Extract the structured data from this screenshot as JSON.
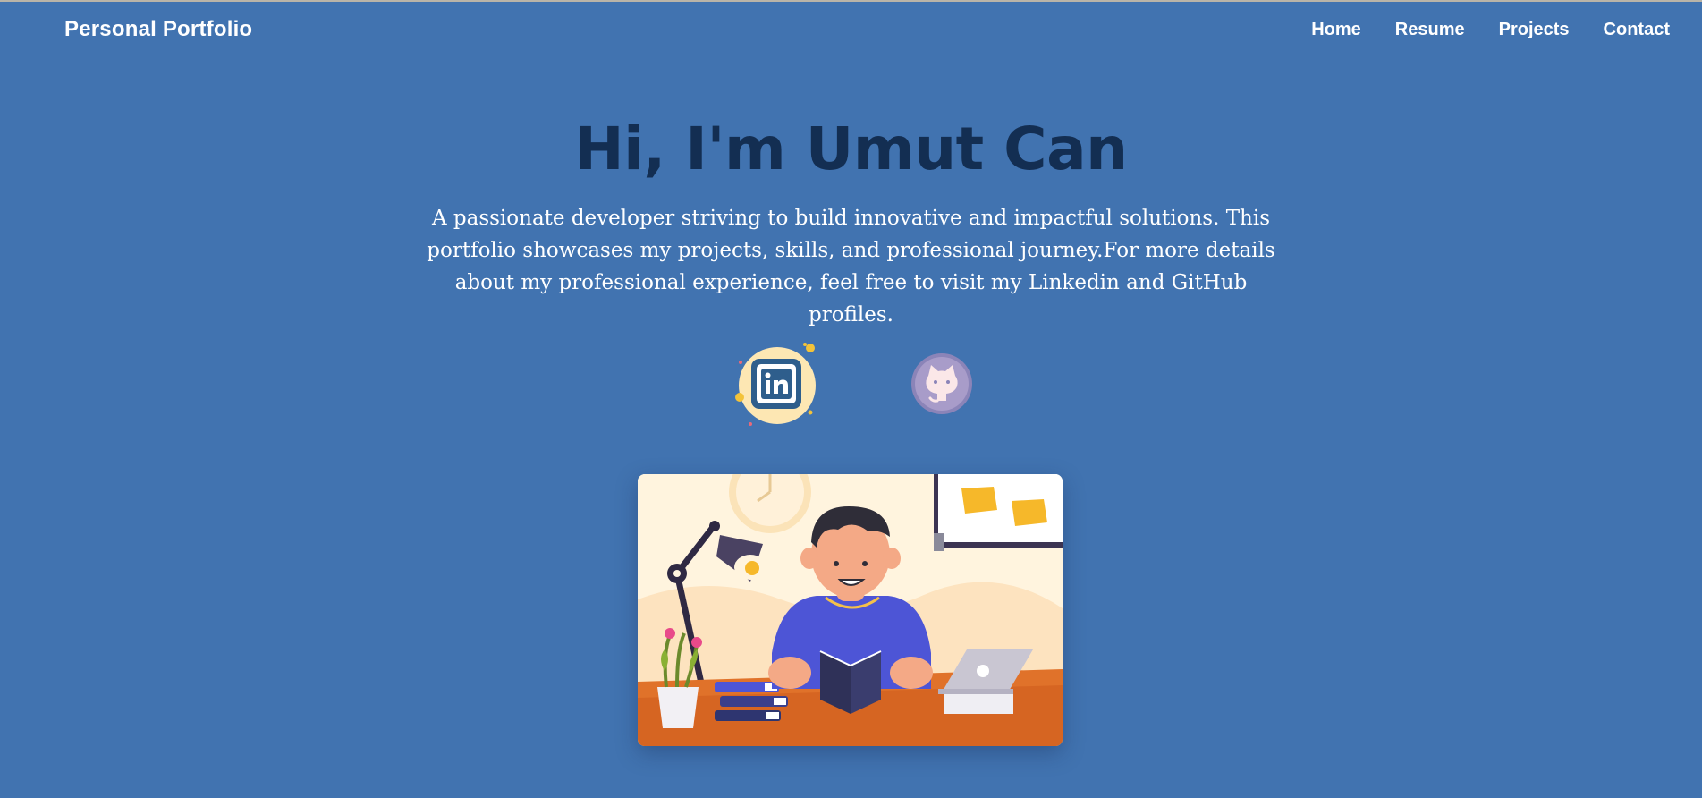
{
  "header": {
    "brand": "Personal Portfolio",
    "nav": [
      {
        "label": "Home"
      },
      {
        "label": "Resume"
      },
      {
        "label": "Projects"
      },
      {
        "label": "Contact"
      }
    ]
  },
  "hero": {
    "title": "Hi, I'm Umut Can",
    "description": "A passionate developer striving to build innovative and impactful solutions. This portfolio showcases my projects, skills, and professional journey.For more details about my professional experience, feel free to visit my Linkedin and GitHub profiles."
  },
  "social": [
    {
      "icon": "linkedin-icon"
    },
    {
      "icon": "github-icon"
    }
  ],
  "colors": {
    "background": "#4173b0",
    "title": "#132e52",
    "text": "#ffffff"
  }
}
